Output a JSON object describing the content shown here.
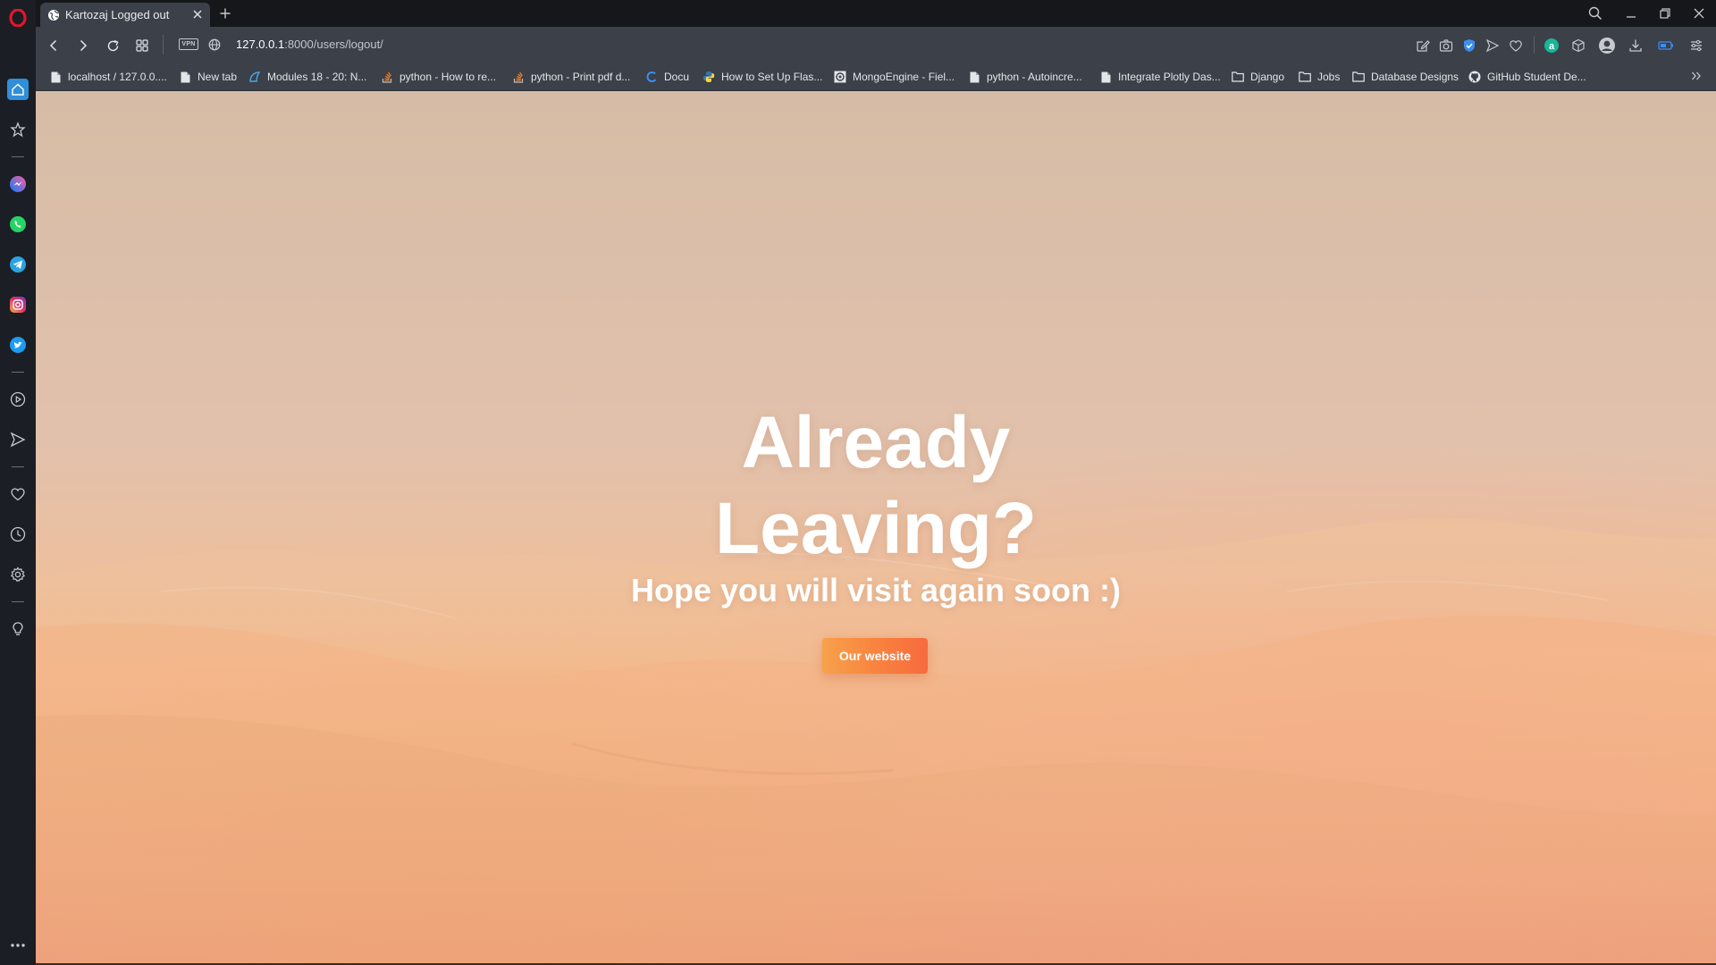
{
  "browser": {
    "tab": {
      "title": "Kartozaj Logged out"
    },
    "address": {
      "vpn_label": "VPN",
      "url_host": "127.0.0.1",
      "url_path": ":8000/users/logout/"
    },
    "bookmarks": [
      {
        "label": "localhost / 127.0.0....",
        "icon": "page-icon"
      },
      {
        "label": "New tab",
        "icon": "page-icon"
      },
      {
        "label": "Modules 18 - 20: N...",
        "icon": "cisco-icon"
      },
      {
        "label": "python - How to re...",
        "icon": "stackoverflow-icon"
      },
      {
        "label": "python - Print pdf d...",
        "icon": "stackoverflow-icon"
      },
      {
        "label": "Docu",
        "icon": "docu-icon"
      },
      {
        "label": "How to Set Up Flas...",
        "icon": "python-icon"
      },
      {
        "label": "MongoEngine - Fiel...",
        "icon": "mongoengine-icon"
      },
      {
        "label": "python - Autoincre...",
        "icon": "page-icon"
      },
      {
        "label": "Integrate Plotly Das...",
        "icon": "page-icon"
      },
      {
        "label": "Django",
        "icon": "folder-icon"
      },
      {
        "label": "Jobs",
        "icon": "folder-icon"
      },
      {
        "label": "Database Designs",
        "icon": "folder-icon"
      },
      {
        "label": "GitHub Student De...",
        "icon": "github-icon"
      }
    ]
  },
  "page": {
    "heading_line1": "Already",
    "heading_line2": "Leaving?",
    "subheading": "Hope you will visit again soon :)",
    "cta_label": "Our website"
  },
  "colors": {
    "cta_gradient_start": "#f7a14a",
    "cta_gradient_end": "#f66b3f",
    "sidebar_bg": "#1b1e24",
    "toolbar_bg": "#3b4049"
  }
}
